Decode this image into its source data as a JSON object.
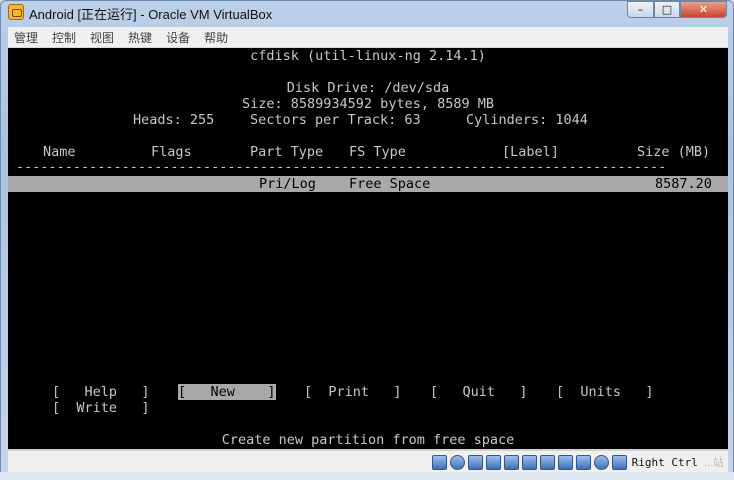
{
  "window": {
    "title": "Android [正在运行] - Oracle VM VirtualBox",
    "minimize_label": "–",
    "maximize_label": "□",
    "close_label": "✕"
  },
  "menu": [
    "管理",
    "控制",
    "视图",
    "热键",
    "设备",
    "帮助"
  ],
  "terminal": {
    "program": "cfdisk (util-linux-ng 2.14.1)",
    "disk_drive": "Disk Drive: /dev/sda",
    "size_line": "Size: 8589934592 bytes, 8589 MB",
    "geometry": {
      "heads": "Heads: 255",
      "sectors": "Sectors per Track: 63",
      "cylinders": "Cylinders: 1044"
    },
    "columns": {
      "name": "Name",
      "flags": "Flags",
      "part_type": "Part Type",
      "fs_type": "FS Type",
      "label": "[Label]",
      "size": "Size (MB)"
    },
    "separator": "--------------------------------------------------------------------------------",
    "partition_row": {
      "part_type": "Pri/Log",
      "fs_type": "Free Space",
      "size": "8587.20"
    },
    "actions": {
      "help": "[   Help   ]",
      "new": "[   New    ]",
      "print": "[  Print   ]",
      "quit": "[   Quit   ]",
      "units": "[  Units   ]",
      "write": "[  Write   ]"
    },
    "selected_action": "New",
    "status_message": "Create new partition from free space"
  },
  "statusbar": {
    "icons": [
      "hard-disk-icon",
      "optical-drive-icon",
      "audio-icon",
      "network-icon",
      "usb-icon",
      "shared-folders-icon",
      "display-icon",
      "video-capture-icon",
      "cpu-icon",
      "mouse-integration-icon",
      "host-key-arrow-icon"
    ],
    "host_key": "Right Ctrl",
    "watermark": "...站"
  }
}
